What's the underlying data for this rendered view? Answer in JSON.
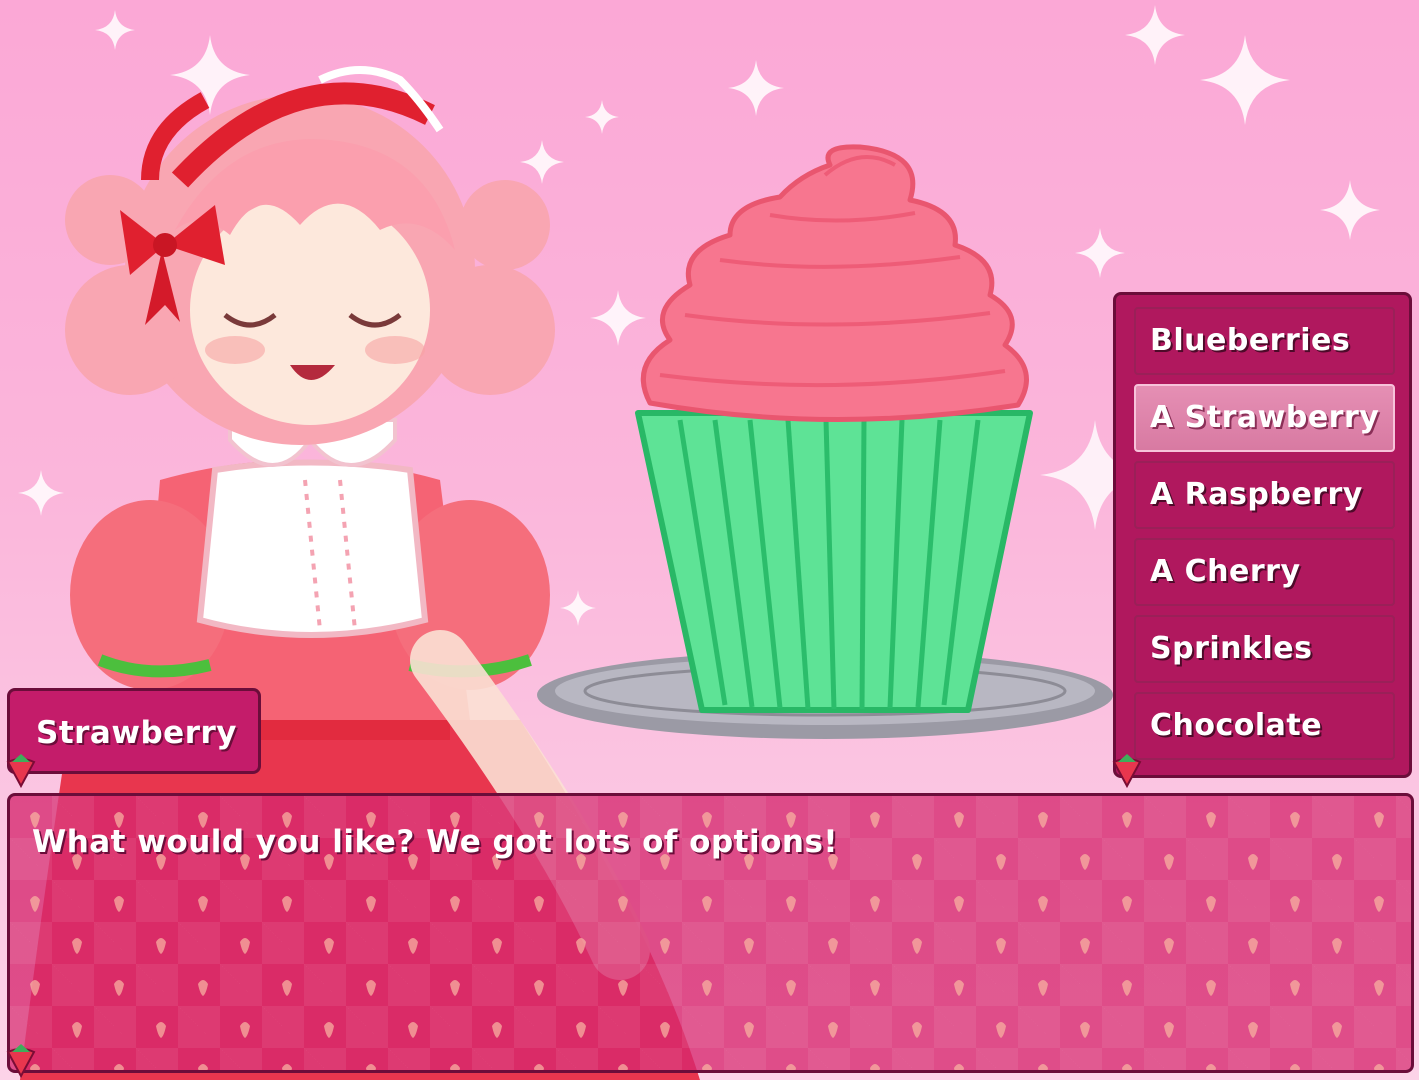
{
  "colors": {
    "background": "#fbb6db",
    "panel": "#b0185e",
    "panel_border": "#6b0d3a",
    "choice_selected": "#e58fb4",
    "frosting": "#f7768f",
    "cupcake_liner": "#5ee396"
  },
  "speaker": {
    "name": "Strawberry"
  },
  "dialogue": {
    "text": "What would you like? We got lots of options!"
  },
  "choices": {
    "items": [
      {
        "label": "Blueberries",
        "selected": false
      },
      {
        "label": "A Strawberry",
        "selected": true
      },
      {
        "label": "A Raspberry",
        "selected": false
      },
      {
        "label": "A Cherry",
        "selected": false
      },
      {
        "label": "Sprinkles",
        "selected": false
      },
      {
        "label": "Chocolate",
        "selected": false
      }
    ]
  },
  "icons": {
    "sparkle": "sparkle-icon",
    "gem": "strawberry-gem-icon"
  }
}
